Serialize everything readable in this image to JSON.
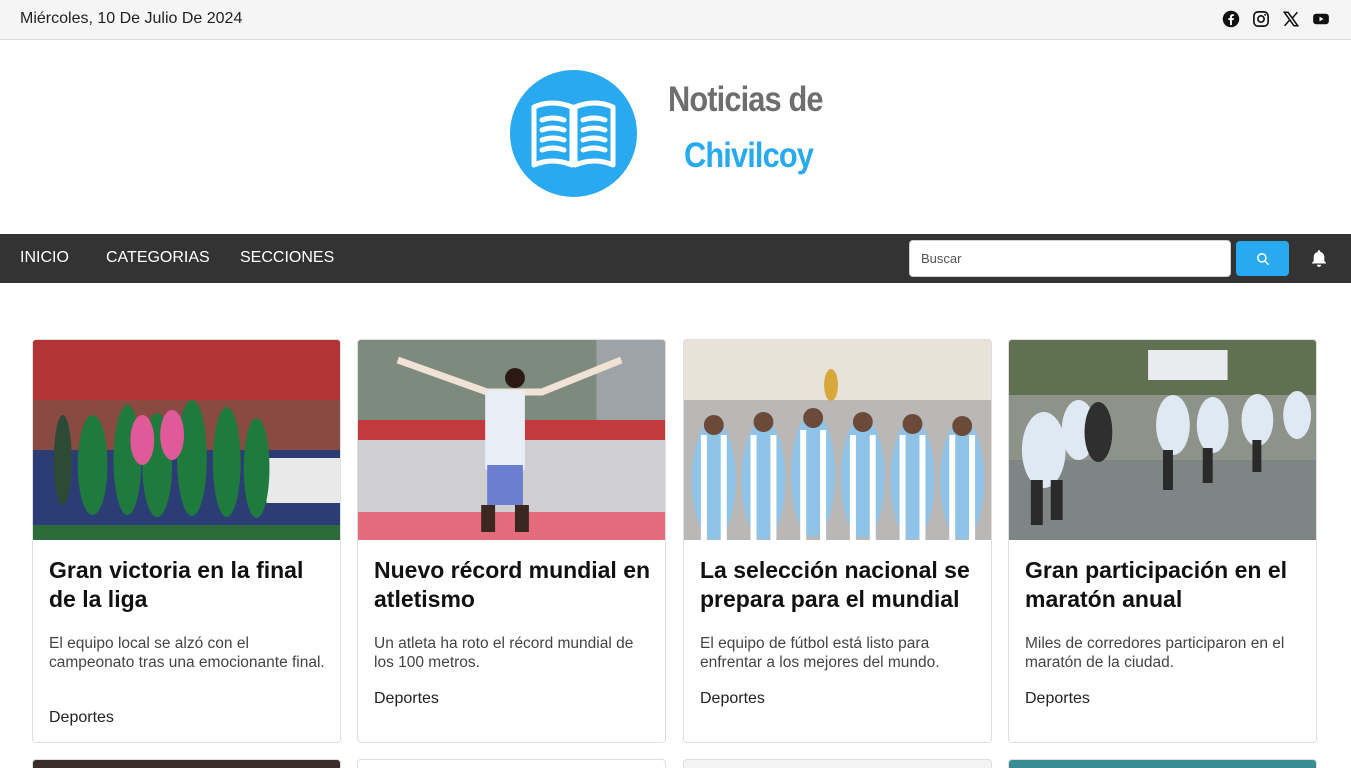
{
  "topbar": {
    "date": "Miércoles, 10 De Julio De 2024",
    "social": [
      {
        "icon": "facebook-icon"
      },
      {
        "icon": "instagram-icon"
      },
      {
        "icon": "x-icon"
      },
      {
        "icon": "youtube-icon"
      }
    ]
  },
  "brand": {
    "line1": "Noticias de",
    "line2": "Chivilcoy",
    "icon": "open-book-icon"
  },
  "colors": {
    "accent": "#29aaf0",
    "nav_bg": "#333333",
    "logo_gray": "#6e6e6e"
  },
  "nav": {
    "items": [
      "INICIO",
      "CATEGORIAS",
      "SECCIONES"
    ],
    "search_placeholder": "Buscar",
    "search_icon": "search-icon",
    "bell_icon": "bell-icon"
  },
  "articles": [
    {
      "title": "Gran victoria en la final de la liga",
      "description": "El equipo local se alzó con el campeonato tras una emocionante final.",
      "category": "Deportes"
    },
    {
      "title": "Nuevo récord mundial en atletismo",
      "description": "Un atleta ha roto el récord mundial de los 100 metros.",
      "category": "Deportes"
    },
    {
      "title": "La selección nacional se prepara para el mundial",
      "description": "El equipo de fútbol está listo para enfrentar a los mejores del mundo.",
      "category": "Deportes"
    },
    {
      "title": "Gran participación en el maratón anual",
      "description": "Miles de corredores participaron en el maratón de la ciudad.",
      "category": "Deportes"
    }
  ]
}
